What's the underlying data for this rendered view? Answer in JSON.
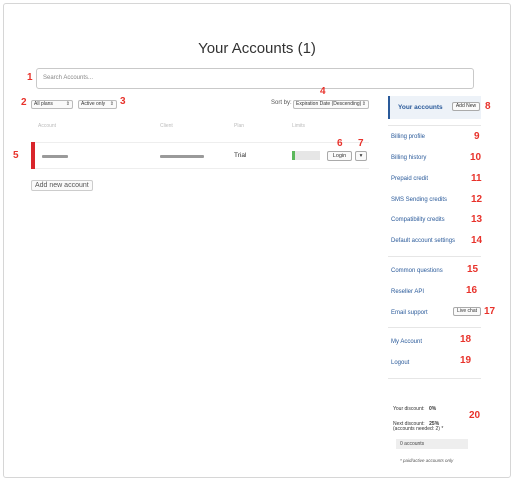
{
  "page": {
    "title": "Your Accounts (1)"
  },
  "search": {
    "placeholder": "Search Accounts..."
  },
  "filters": {
    "plan_select": "All plans",
    "status_select": "Active only",
    "sort_label": "Sort by:",
    "sort_select": "Expiration Date (Descending)"
  },
  "table": {
    "headers": [
      "Account",
      "Client",
      "Plan",
      "Limits"
    ],
    "rows": [
      {
        "plan": "Trial",
        "limits_usage": 0.12,
        "login_label": "Login",
        "menu_caret": "▾"
      }
    ]
  },
  "add_account": "Add new account",
  "sidebar": {
    "heading": "Your accounts",
    "add_new": "Add New",
    "group1": [
      "Billing profile",
      "Billing history",
      "Prepaid credit",
      "SMS Sending credits",
      "Compatibility credits",
      "Default account settings"
    ],
    "group2": [
      "Common questions",
      "Reseller API",
      "Email support"
    ],
    "live_chat": "Live chat",
    "group3": [
      "My Account",
      "Logout"
    ]
  },
  "discount": {
    "your_label": "Your discount:",
    "your_value": "0%",
    "next_label": "Next discount:",
    "next_value": "25%",
    "needed": "(accounts needed: 2) *",
    "accounts_value": "0 accounts",
    "footnote": "* paid/active accounts only"
  },
  "markers": [
    "1",
    "2",
    "3",
    "4",
    "5",
    "6",
    "7",
    "8",
    "9",
    "10",
    "11",
    "12",
    "13",
    "14",
    "15",
    "16",
    "17",
    "18",
    "19",
    "20"
  ],
  "colors": {
    "marker_red": "#e8322b",
    "link_blue": "#2a5a9a",
    "row_accent": "#d9252b",
    "usage_green": "#5cb85c"
  }
}
